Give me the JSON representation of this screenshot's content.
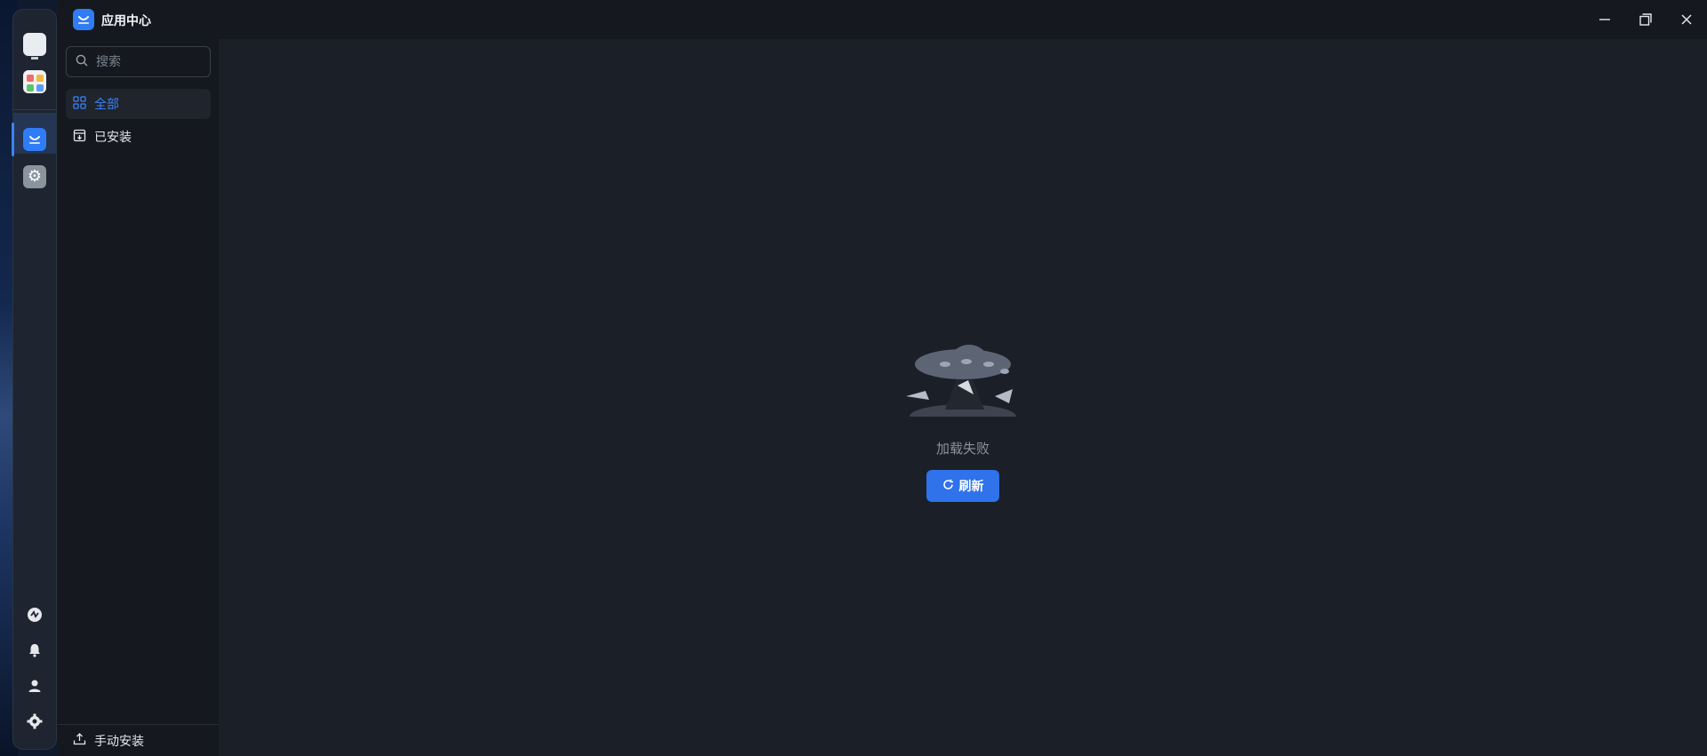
{
  "app": {
    "title": "应用中心"
  },
  "dock": {
    "apps": [
      {
        "name": "monitor-app",
        "icon": "monitor-icon"
      },
      {
        "name": "apps-launcher",
        "icon": "apps-grid-icon"
      },
      {
        "name": "app-center",
        "icon": "store-icon",
        "active": true
      },
      {
        "name": "system-settings",
        "icon": "gear-icon"
      }
    ],
    "system": [
      "status-icon",
      "bell-icon",
      "user-icon",
      "gear-icon"
    ]
  },
  "sidebar": {
    "search_placeholder": "搜索",
    "items": [
      {
        "label": "全部",
        "icon": "grid-icon",
        "active": true
      },
      {
        "label": "已安装",
        "icon": "installed-icon",
        "active": false
      }
    ],
    "footer_label": "手动安装"
  },
  "main": {
    "empty_text": "加载失败",
    "refresh_label": "刷新"
  },
  "colors": {
    "accent": "#2f72ea",
    "active_text": "#3b82f6",
    "background": "#1b1f27",
    "sidebar": "#15181e"
  }
}
